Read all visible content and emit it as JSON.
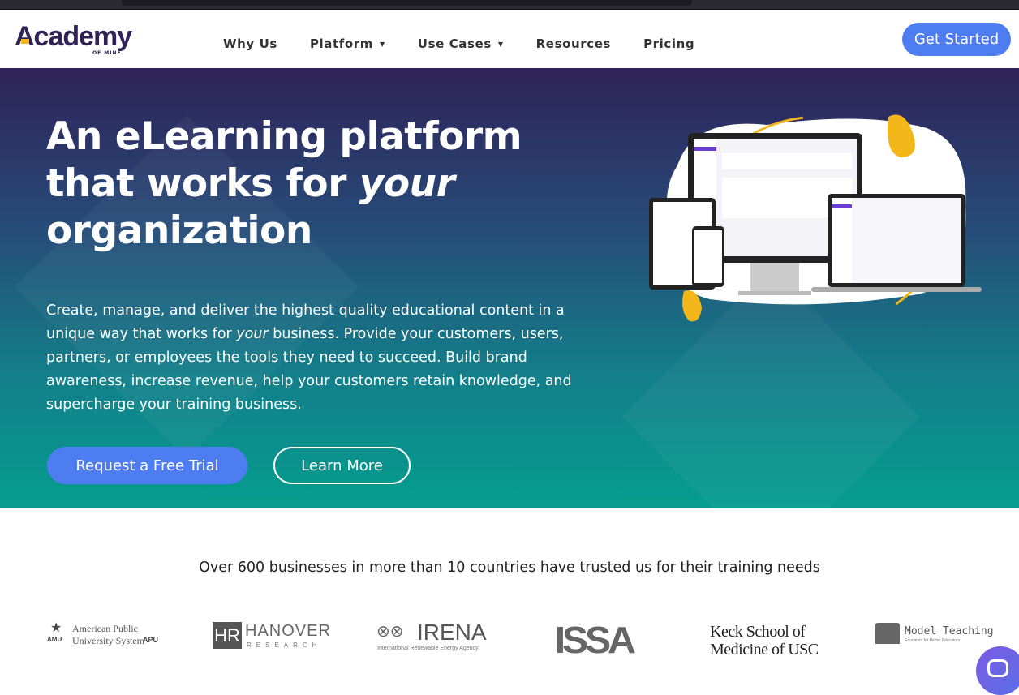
{
  "nav": {
    "logo": "Academy",
    "logo_sub": "OF MINE",
    "items": [
      {
        "label": "Why Us",
        "dropdown": false
      },
      {
        "label": "Platform",
        "dropdown": true
      },
      {
        "label": "Use Cases",
        "dropdown": true
      },
      {
        "label": "Resources",
        "dropdown": false
      },
      {
        "label": "Pricing",
        "dropdown": false
      }
    ],
    "cta": "Get Started"
  },
  "hero": {
    "title_line1": "An eLearning platform",
    "title_line2a": "that works for ",
    "title_line2b": "your",
    "title_line3": "organization",
    "desc_a": "Create, manage, and deliver the highest quality educational content in a unique way that works for ",
    "desc_em": "your",
    "desc_b": " business. Provide your customers, users, partners, or employees the tools they need to succeed.  Build brand awareness, increase revenue, help your customers retain knowledge, and supercharge your training business.",
    "primary_button": "Request a Free Trial",
    "secondary_button": "Learn More"
  },
  "trust": {
    "text": "Over 600 businesses in more than 10 countries have trusted us for their training needs",
    "logos": {
      "amu1": "American Public",
      "amu2": "University System",
      "amu_a": "AMU",
      "amu_b": "APU",
      "hanover": "HANOVER",
      "hanover_sub": "RESEARCH",
      "irena": "IRENA",
      "irena_sub": "International Renewable Energy Agency",
      "issa": "ISSA",
      "keck1": "Keck School of",
      "keck2": "Medicine of USC",
      "mt": "Model Teaching",
      "mt_sub": "Education for Better Educators"
    }
  },
  "colors": {
    "brand": "#2e2257",
    "accent": "#4e7df2",
    "teal": "#059e8e",
    "yellow": "#f3b71a"
  }
}
